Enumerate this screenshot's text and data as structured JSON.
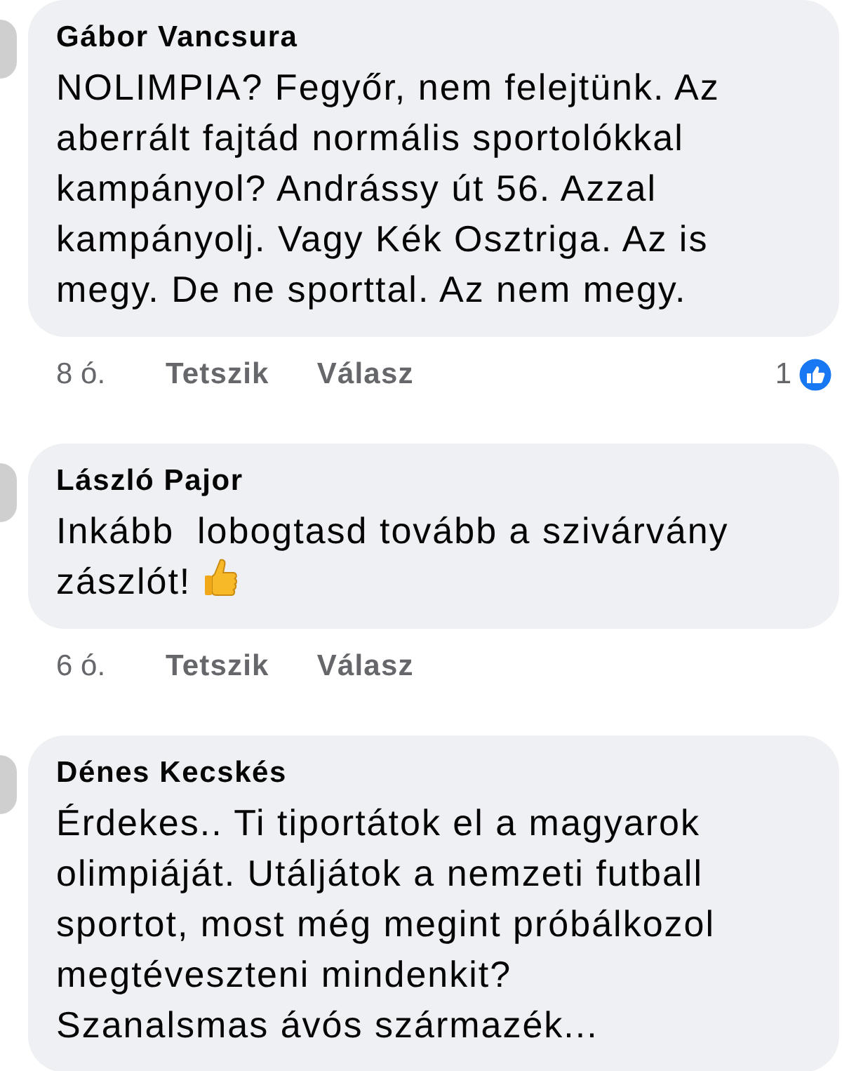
{
  "comments": [
    {
      "author": "Gábor Vancsura",
      "lines": [
        "NOLIMPIA? Fegyőr, nem felejtünk. Az",
        "aberrált fajtád normális sportolókkal",
        "kampányol? Andrássy út 56. Azzal",
        "kampányolj. Vagy Kék Osztriga. Az is",
        "megy. De ne sporttal. Az nem megy."
      ],
      "emoji": false,
      "time": "8 ó.",
      "actions": [
        "Tetszik",
        "Válasz"
      ],
      "reactions": "1"
    },
    {
      "author": "László Pajor",
      "lines": [
        "Inkább  lobogtasd tovább a szivárvány",
        "zászlót!"
      ],
      "emoji": true,
      "time": "6 ó.",
      "actions": [
        "Tetszik",
        "Válasz"
      ]
    },
    {
      "author": "Dénes Kecskés",
      "lines": [
        "Érdekes.. Ti tiportátok el a magyarok",
        "olimpiáját. Utáljátok a nemzeti futball",
        "sportot, most még megint próbálkozol",
        "megtéveszteni mindenkit?",
        "Szanalsmas ávós származék..."
      ],
      "emoji": false
    }
  ]
}
